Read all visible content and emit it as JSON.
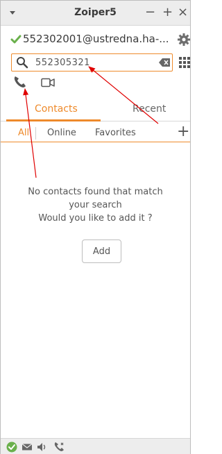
{
  "window": {
    "title": "Zoiper5",
    "minimize": "−",
    "maximize": "+",
    "close": "×"
  },
  "account": {
    "name": "552302001@ustredna.ha-...",
    "status_color": "#6ab04c"
  },
  "search": {
    "value": "552305321"
  },
  "tabs": [
    {
      "label": "Contacts",
      "active": true
    },
    {
      "label": "Recent",
      "active": false
    }
  ],
  "filters": [
    {
      "label": "All",
      "active": true
    },
    {
      "label": "Online",
      "active": false
    },
    {
      "label": "Favorites",
      "active": false
    }
  ],
  "add_contact_symbol": "+",
  "empty_state": {
    "line1": "No contacts found that match",
    "line2": "your search",
    "line3": "Would you like to add it ?",
    "add_label": "Add"
  },
  "colors": {
    "accent": "#ee8a2b",
    "annotation": "#e00000"
  },
  "icons": [
    "menu-icon",
    "checkmark-icon",
    "gear-icon",
    "search-icon",
    "backspace-icon",
    "dialpad-icon",
    "phone-icon",
    "video-icon",
    "add-icon",
    "status-ok-icon",
    "mail-icon",
    "volume-icon",
    "call-settings-icon"
  ]
}
